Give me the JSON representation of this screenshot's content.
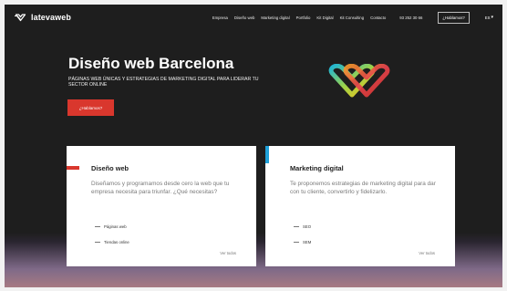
{
  "brand": {
    "name": "latevaweb"
  },
  "nav": {
    "items": [
      "Empresa",
      "Diseño web",
      "Marketing digital",
      "Portfolio",
      "Kit Digital",
      "Kit Consulting",
      "Contacto"
    ],
    "phone": "93 252 30 66",
    "cta_label": "¿Hablamos?",
    "language": "ES"
  },
  "hero": {
    "title": "Diseño web Barcelona",
    "subtitle": "Páginas web únicas y estrategias de marketing digital para liderar tu sector online",
    "cta_label": "¿Hablamos?"
  },
  "cards": [
    {
      "title": "Diseño web",
      "description": "Diseñamos y programamos desde cero la web que tu empresa necesita para triunfar. ¿Qué necesitas?",
      "items": [
        "Páginas web",
        "Tiendas online"
      ],
      "link": "Ver todos"
    },
    {
      "title": "Marketing digital",
      "description": "Te proponemos estrategias de marketing digital para dar con tu cliente, convertirlo y fidelizarlo.",
      "items": [
        "SEO",
        "SEM"
      ],
      "link": "Ver todos"
    }
  ],
  "colors": {
    "accent_red": "#d9372d",
    "accent_blue": "#1fa1d9",
    "background": "#1e1e1e"
  },
  "icons": {
    "logo": "heart-logo-icon",
    "hero_graphic": "interlocked-hearts-icon",
    "language_dropdown": "chevron-down-icon"
  }
}
